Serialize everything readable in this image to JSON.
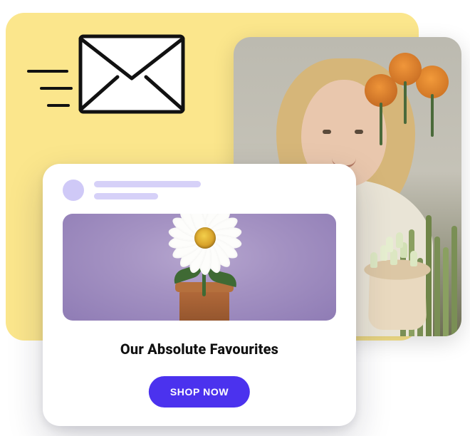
{
  "icons": {
    "envelope": "envelope-icon",
    "speed_lines": "speed-lines-icon"
  },
  "colors": {
    "yellow_card": "#fbe68c",
    "cta_bg": "#4b32ee",
    "cta_text": "#ffffff",
    "placeholder": "#cfc9f7",
    "hero_bg": "#9a87bf"
  },
  "email_card": {
    "title": "Our Absolute Favourites",
    "cta_label": "SHOP NOW"
  }
}
